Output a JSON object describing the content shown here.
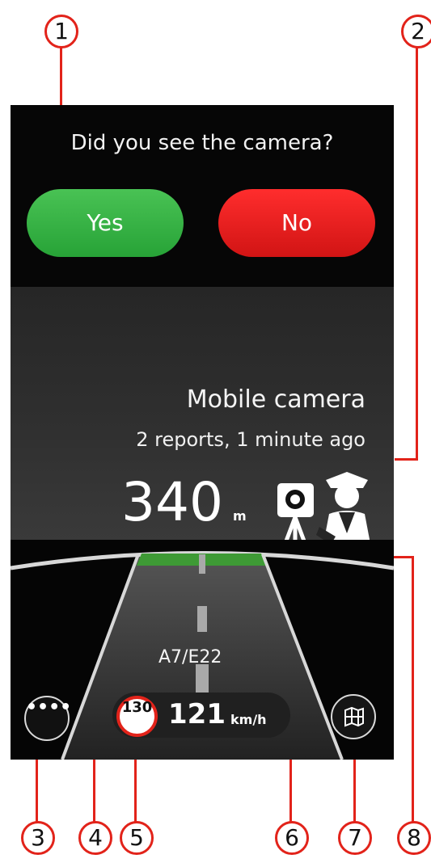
{
  "prompt": {
    "question": "Did you see the camera?",
    "yes_label": "Yes",
    "no_label": "No"
  },
  "warning": {
    "title": "Mobile camera",
    "reports": "2 reports, 1 minute ago",
    "distance": "340",
    "distance_unit": "m",
    "icon": "mobile-speed-camera-with-police-officer-icon"
  },
  "road": {
    "route": "A7/E22"
  },
  "speed": {
    "limit": "130",
    "current": "121",
    "unit": "km/h"
  },
  "controls": {
    "menu_label": "••••",
    "menu_icon": "more-dots-icon",
    "map_icon": "map-icon"
  },
  "callouts": [
    "1",
    "2",
    "3",
    "4",
    "5",
    "6",
    "7",
    "8"
  ],
  "colors": {
    "accent_red": "#e2231a",
    "yes_green": "#35ad43",
    "no_red": "#ec1f1f",
    "route_green": "#3e9a35"
  }
}
